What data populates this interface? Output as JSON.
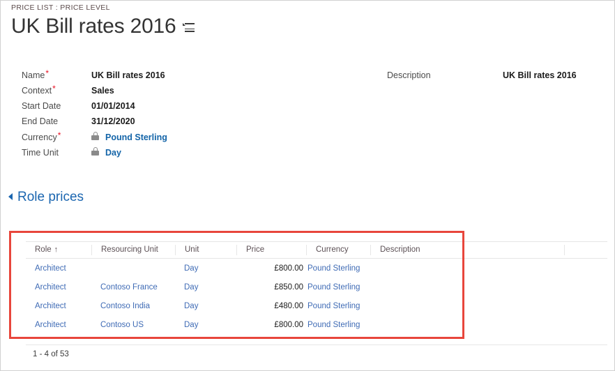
{
  "header": {
    "breadcrumb": "PRICE LIST : PRICE LEVEL",
    "title": "UK Bill rates 2016",
    "menu_icon": "list-menu-icon"
  },
  "form": {
    "left_fields": [
      {
        "label": "Name",
        "required": true,
        "value": "UK Bill rates 2016",
        "locked": false,
        "link": false
      },
      {
        "label": "Context",
        "required": true,
        "value": "Sales",
        "locked": false,
        "link": false
      },
      {
        "label": "Start Date",
        "required": false,
        "value": "01/01/2014",
        "locked": false,
        "link": false
      },
      {
        "label": "End Date",
        "required": false,
        "value": "31/12/2020",
        "locked": false,
        "link": false
      },
      {
        "label": "Currency",
        "required": true,
        "value": "Pound Sterling",
        "locked": true,
        "link": true
      },
      {
        "label": "Time Unit",
        "required": false,
        "value": "Day",
        "locked": true,
        "link": true
      }
    ],
    "right_fields": [
      {
        "label": "Description",
        "required": false,
        "value": "UK Bill rates 2016",
        "locked": false,
        "link": false
      }
    ]
  },
  "section": {
    "title": "Role prices",
    "expanded": true,
    "caret_icon": "triangle-collapse-icon"
  },
  "grid": {
    "columns": [
      {
        "key": "role",
        "label": "Role",
        "sorted": true,
        "sort_icon": "↑"
      },
      {
        "key": "resourcing_unit",
        "label": "Resourcing Unit",
        "sorted": false,
        "sort_icon": ""
      },
      {
        "key": "unit",
        "label": "Unit",
        "sorted": false,
        "sort_icon": ""
      },
      {
        "key": "price",
        "label": "Price",
        "sorted": false,
        "sort_icon": ""
      },
      {
        "key": "currency",
        "label": "Currency",
        "sorted": false,
        "sort_icon": ""
      },
      {
        "key": "description",
        "label": "Description",
        "sorted": false,
        "sort_icon": ""
      }
    ],
    "rows": [
      {
        "role": "Architect",
        "resourcing_unit": "",
        "unit": "Day",
        "price": "£800.00",
        "currency": "Pound Sterling",
        "description": ""
      },
      {
        "role": "Architect",
        "resourcing_unit": "Contoso France",
        "unit": "Day",
        "price": "£850.00",
        "currency": "Pound Sterling",
        "description": ""
      },
      {
        "role": "Architect",
        "resourcing_unit": "Contoso India",
        "unit": "Day",
        "price": "£480.00",
        "currency": "Pound Sterling",
        "description": ""
      },
      {
        "role": "Architect",
        "resourcing_unit": "Contoso US",
        "unit": "Day",
        "price": "£800.00",
        "currency": "Pound Sterling",
        "description": ""
      }
    ]
  },
  "footer": {
    "record_count": "1 - 4 of 53"
  },
  "colors": {
    "link": "#3f6bb5",
    "section_accent": "#1b66b0",
    "required_asterisk": "#e81123",
    "annotation": "#e8463c",
    "grid_line": "#e6e6e6"
  }
}
